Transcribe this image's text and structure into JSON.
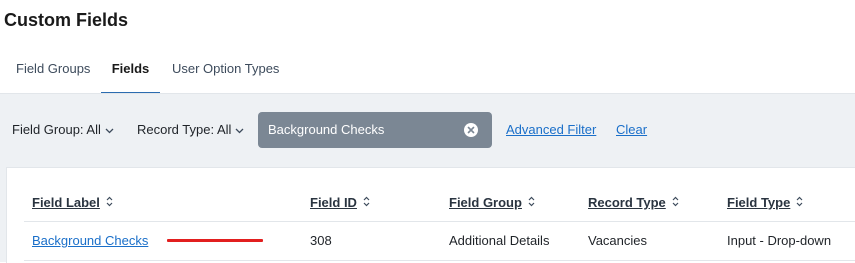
{
  "page": {
    "title": "Custom Fields"
  },
  "tabs": [
    {
      "label": "Field Groups"
    },
    {
      "label": "Fields"
    },
    {
      "label": "User Option Types"
    }
  ],
  "filters": {
    "field_group": "Field Group: All",
    "record_type": "Record Type: All",
    "search_value": "Background Checks",
    "advanced_filter": "Advanced Filter",
    "clear": "Clear"
  },
  "table": {
    "columns": [
      "Field Label",
      "Field ID",
      "Field Group",
      "Record Type",
      "Field Type"
    ],
    "rows": [
      [
        "Background Checks",
        "308",
        "Additional Details",
        "Vacancies",
        "Input - Drop-down"
      ]
    ]
  },
  "colors": {
    "accent": "#2b6cb0",
    "link": "#1a6fc9",
    "search_bg": "#7b8794",
    "filter_bg": "#eef1f4",
    "annotation": "#e21f1f"
  },
  "icons": [
    "chevron-down-icon",
    "clear-x-icon",
    "sort-icon"
  ]
}
